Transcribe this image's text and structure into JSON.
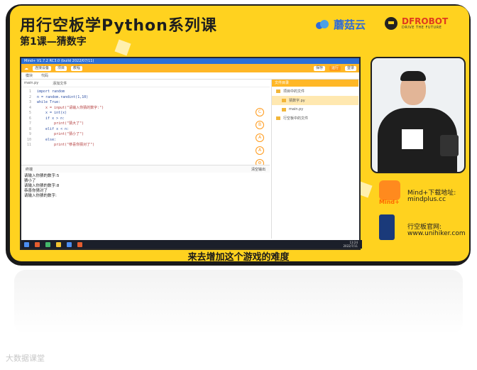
{
  "course_title": "用行空板学Python系列课",
  "lesson_title": "第1课—猜数字",
  "brands": {
    "cloud": "蘑菇云",
    "dfrobot": "DFROBOT",
    "dfrobot_tagline": "DRIVE THE FUTURE"
  },
  "ide": {
    "titlebar": "Mind+ V1.7.2 RC3.0 (build 2022/07/11)",
    "toolbar_buttons": [
      "连接设备",
      "项目",
      "教程"
    ],
    "toolbar_right": [
      "保存",
      "运行",
      "登录"
    ],
    "tabs": [
      "模块",
      "代码"
    ],
    "file_tabs": [
      "main.py",
      "添加文件"
    ],
    "code_lines": [
      {
        "n": "1",
        "t": "import random"
      },
      {
        "n": "2",
        "t": "n = random.randint(1,10)"
      },
      {
        "n": "3",
        "t": "while True:"
      },
      {
        "n": "4",
        "t": "    x = input(\"请输入你猜的数字:\")"
      },
      {
        "n": "5",
        "t": "    x = int(x)"
      },
      {
        "n": "6",
        "t": "    if x > n:"
      },
      {
        "n": "7",
        "t": "        print(\"猜大了\")"
      },
      {
        "n": "8",
        "t": "    elif x < n:"
      },
      {
        "n": "9",
        "t": "        print(\"猜小了\")"
      },
      {
        "n": "10",
        "t": "    else:"
      },
      {
        "n": "11",
        "t": "        print(\"恭喜你猜对了\")"
      }
    ],
    "terminal_title": "终端",
    "terminal_clear": "清空输出",
    "terminal_lines": [
      "请输入你猜的数字:5",
      "猜小了",
      "请输入你猜的数字:8",
      "恭喜你猜对了",
      "请输入你猜的数字:"
    ],
    "right_panel_title": "文件目录",
    "right_items": [
      "项目中的文件",
      "猜数字.py",
      "main.py",
      "行空板中的文件"
    ],
    "clock": "13:24",
    "date": "2022/7/11"
  },
  "mindplus": {
    "label": "Mind+下载地址:",
    "url": "mindplus.cc",
    "logo": "Mind+"
  },
  "unihiker": {
    "label": "行空板官网:",
    "url": "www.unihiker.com"
  },
  "subtitle": "来去增加这个游戏的难度",
  "watermark": "大数据课堂"
}
